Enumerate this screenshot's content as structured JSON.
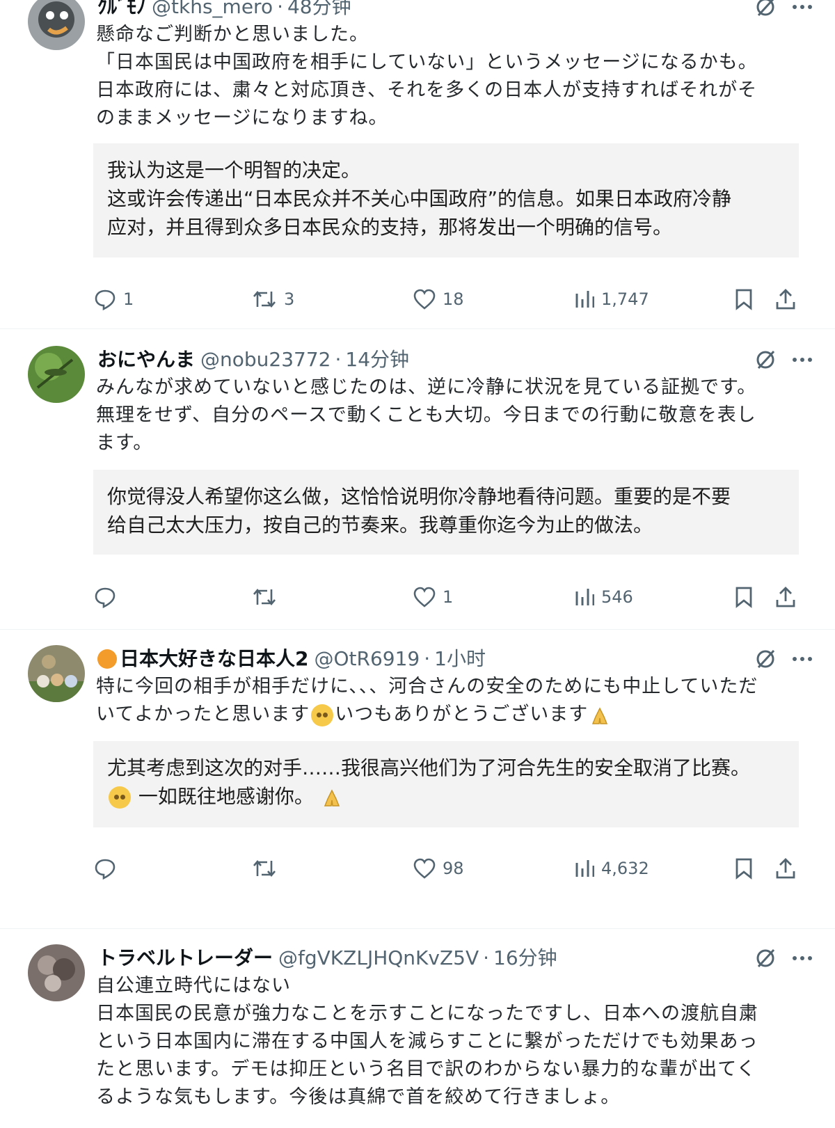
{
  "colors": {
    "muted": "#536471",
    "translation_bg": "#f3f3f3",
    "divider": "#eff3f4"
  },
  "posts": [
    {
      "name": "ｸﾙﾞﾓﾉ",
      "handle": "@tkhs_mero",
      "time": "48分钟",
      "text_lines": [
        "懸命なご判断かと思いました。",
        "「日本国民は中国政府を相手にしていない」というメッセージになるかも。",
        "日本政府には、粛々と対応頂き、それを多くの日本人が支持すればそれがそ",
        "のままメッセージになりますね。"
      ],
      "translation_lines": [
        "我认为这是一个明智的决定。",
        "这或许会传递出“日本民众并不关心中国政府”的信息。如果日本政府冷静",
        "应对，并且得到众多日本民众的支持，那将发出一个明确的信号。"
      ],
      "replies": "1",
      "reposts": "3",
      "likes": "18",
      "views": "1,747"
    },
    {
      "name": "おにやんま",
      "handle": "@nobu23772",
      "time": "14分钟",
      "text_lines": [
        "みんなが求めていないと感じたのは、逆に冷静に状況を見ている証拠です。",
        "無理をせず、自分のペースで動くことも大切。今日までの行動に敬意を表し",
        "ます。"
      ],
      "translation_lines": [
        "你觉得没人希望你这么做，这恰恰说明你冷静地看待问题。重要的是不要",
        "给自己太大压力，按自己的节奏来。我尊重你迄今为止的做法。"
      ],
      "replies": "",
      "reposts": "",
      "likes": "1",
      "views": "546"
    },
    {
      "name": "日本大好きな日本人2",
      "handle": "@OtR6919",
      "time": "1小时",
      "text_lines": [
        "特に今回の相手が相手だけに、、、河合さんの安全のためにも中止していただ",
        "いてよかったと思います",
        "いつもありがとうございます"
      ],
      "translation_lines": [
        "尤其考虑到这次的对手……我很高兴他们为了河合先生的安全取消了比赛。",
        "一如既往地感谢你。"
      ],
      "replies": "",
      "reposts": "",
      "likes": "98",
      "views": "4,632"
    },
    {
      "name": "トラベルトレーダー",
      "handle": "@fgVKZLJHQnKvZ5V",
      "time": "16分钟",
      "text_lines": [
        "自公連立時代にはない",
        "日本国民の民意が強力なことを示すことになったですし、日本への渡航自粛",
        "という日本国内に滞在する中国人を減らすことに繋がっただけでも効果あっ",
        "たと思います。デモは抑圧という名目で訳のわからない暴力的な輩が出てく",
        "るような気もします。今後は真綿で首を絞めて行きましょ。"
      ]
    }
  ],
  "icons": {
    "grok": "grok-icon",
    "more": "more-icon",
    "reply": "reply-icon",
    "repost": "repost-icon",
    "like": "like-icon",
    "views": "views-icon",
    "bookmark": "bookmark-icon",
    "share": "share-icon"
  }
}
